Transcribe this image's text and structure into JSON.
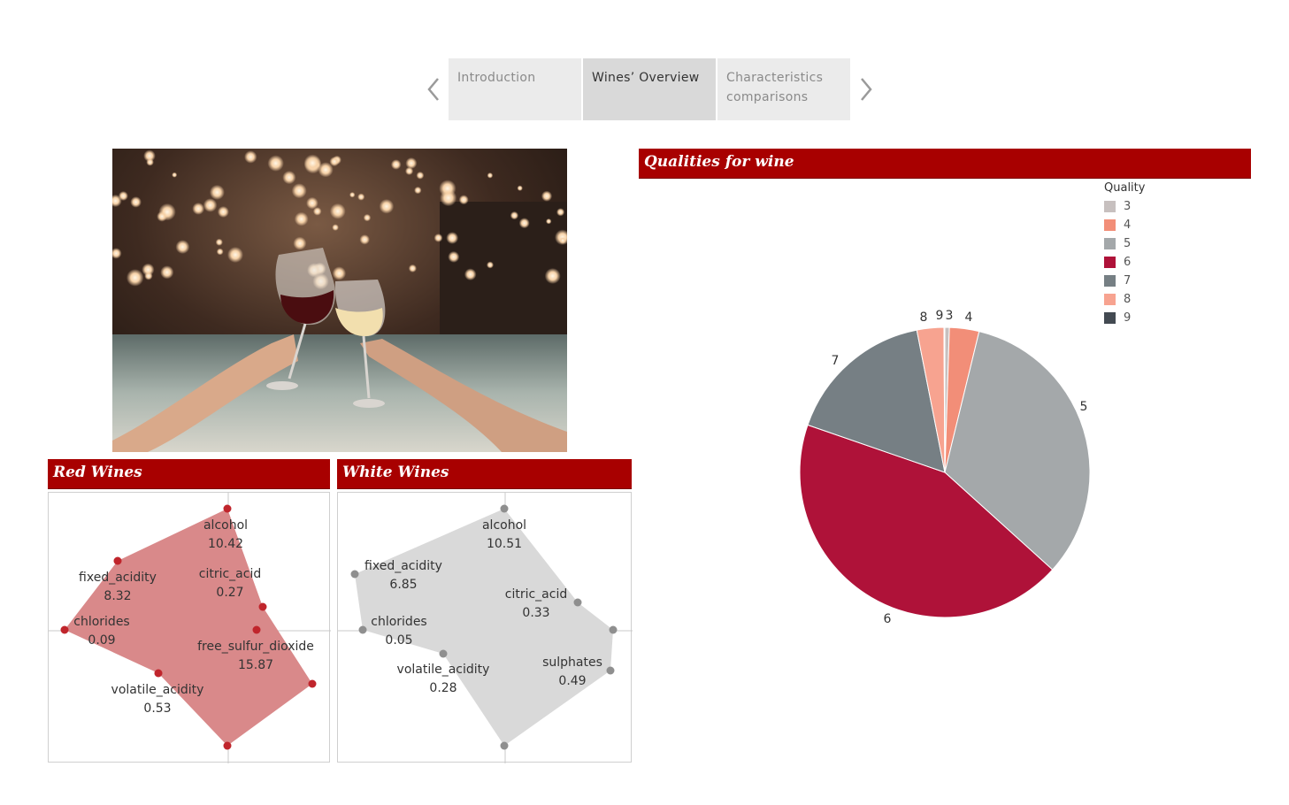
{
  "story_nav": {
    "prev_label": "previous",
    "next_label": "next",
    "tabs": [
      {
        "label": "Introduction",
        "active": false
      },
      {
        "label": "Wines’ Overview",
        "active": true
      },
      {
        "label": "Characteristics comparisons",
        "active": false
      }
    ]
  },
  "photo": {
    "subject": "two hands toasting with red and white wine glasses in a bar"
  },
  "red_wines": {
    "title": "Red Wines",
    "color": "#d9898a",
    "point_color": "#c0252c",
    "labels": [
      {
        "name": "alcohol",
        "value": "10.42"
      },
      {
        "name": "fixed_acidity",
        "value": "8.32"
      },
      {
        "name": "citric_acid",
        "value": "0.27"
      },
      {
        "name": "chlorides",
        "value": "0.09"
      },
      {
        "name": "free_sulfur_dioxide",
        "value": "15.87"
      },
      {
        "name": "volatile_acidity",
        "value": "0.53"
      }
    ]
  },
  "white_wines": {
    "title": "White Wines",
    "color": "#d9d9d9",
    "point_color": "#8f8f8f",
    "labels": [
      {
        "name": "alcohol",
        "value": "10.51"
      },
      {
        "name": "fixed_acidity",
        "value": "6.85"
      },
      {
        "name": "citric_acid",
        "value": "0.33"
      },
      {
        "name": "chlorides",
        "value": "0.05"
      },
      {
        "name": "sulphates",
        "value": "0.49"
      },
      {
        "name": "volatile_acidity",
        "value": "0.28"
      }
    ]
  },
  "quality_chart": {
    "title": "Qualities for wine",
    "legend_title": "Quality"
  },
  "chart_data": {
    "type": "pie",
    "title": "Qualities for wine",
    "legend_title": "Quality",
    "legend_position": "top-right",
    "categories": [
      "3",
      "4",
      "5",
      "6",
      "7",
      "8",
      "9"
    ],
    "values": [
      0.5,
      3.3,
      32.9,
      43.6,
      16.6,
      3.0,
      0.1
    ],
    "colors": [
      "#c7c0bf",
      "#f28e78",
      "#a4a8aa",
      "#af1239",
      "#767f84",
      "#f7a390",
      "#434a52"
    ]
  }
}
